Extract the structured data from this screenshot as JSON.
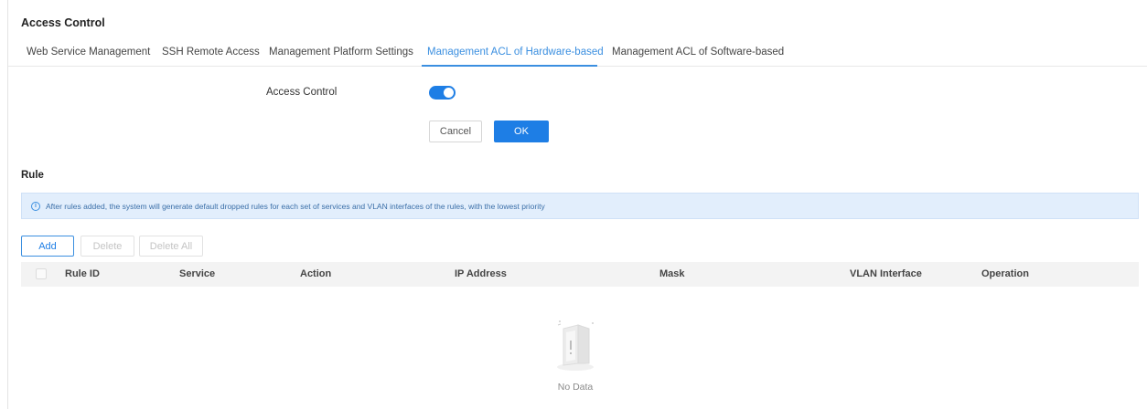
{
  "page": {
    "title": "Access Control"
  },
  "tabs": [
    {
      "label": "Web Service Management",
      "active": false
    },
    {
      "label": "SSH Remote Access",
      "active": false
    },
    {
      "label": "Management Platform Settings",
      "active": false
    },
    {
      "label": "Management ACL of Hardware-based",
      "active": true
    },
    {
      "label": "Management ACL of Software-based",
      "active": false
    }
  ],
  "form": {
    "access_control_label": "Access Control",
    "access_control_enabled": true,
    "cancel_label": "Cancel",
    "ok_label": "OK"
  },
  "rule": {
    "title": "Rule",
    "info_icon": "ⓘ",
    "info_text": "After rules added, the system will generate default dropped rules for each set of services and VLAN interfaces of the rules, with the lowest priority",
    "buttons": {
      "add": "Add",
      "delete": "Delete",
      "delete_all": "Delete All"
    },
    "columns": [
      "Rule ID",
      "Service",
      "Action",
      "IP Address",
      "Mask",
      "VLAN Interface",
      "Operation"
    ],
    "empty_text": "No Data"
  },
  "colors": {
    "accent": "#1e7ee5",
    "banner_bg": "#e2eefc",
    "header_bg": "#f3f3f3"
  },
  "icons": {
    "info": "info-icon",
    "empty": "no-data-icon"
  }
}
